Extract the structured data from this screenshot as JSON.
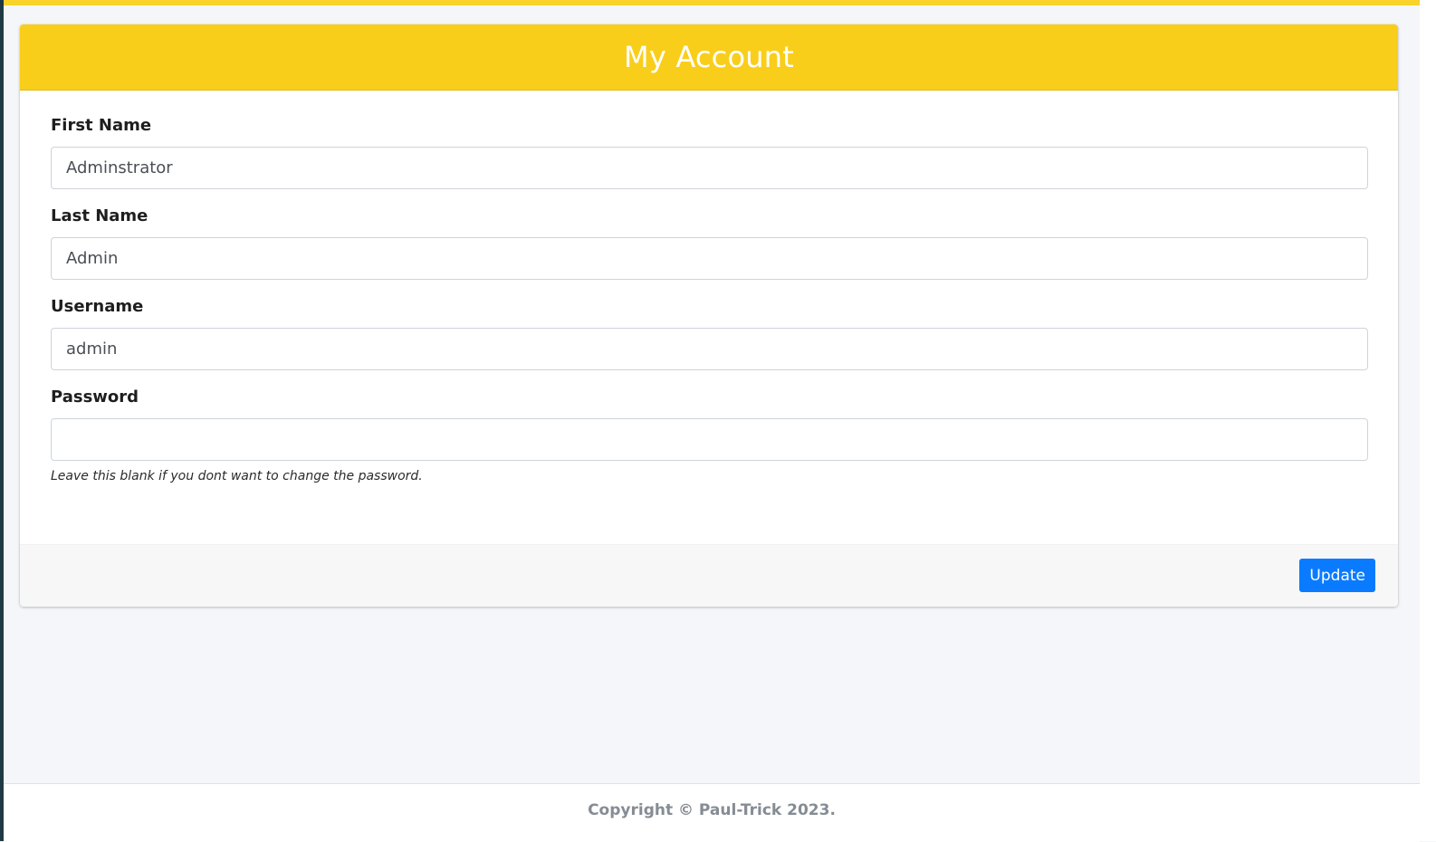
{
  "card": {
    "title": "My Account"
  },
  "form": {
    "first_name": {
      "label": "First Name",
      "value": "Adminstrator"
    },
    "last_name": {
      "label": "Last Name",
      "value": "Admin"
    },
    "username": {
      "label": "Username",
      "value": "admin"
    },
    "password": {
      "label": "Password",
      "value": "",
      "help": "Leave this blank if you dont want to change the password."
    }
  },
  "footer_actions": {
    "update_label": "Update"
  },
  "page_footer": {
    "copyright": "Copyright © Paul-Trick 2023."
  },
  "colors": {
    "header": "#f9ce1b",
    "accent": "#0a7bff",
    "page_background": "#f4f6f9"
  }
}
